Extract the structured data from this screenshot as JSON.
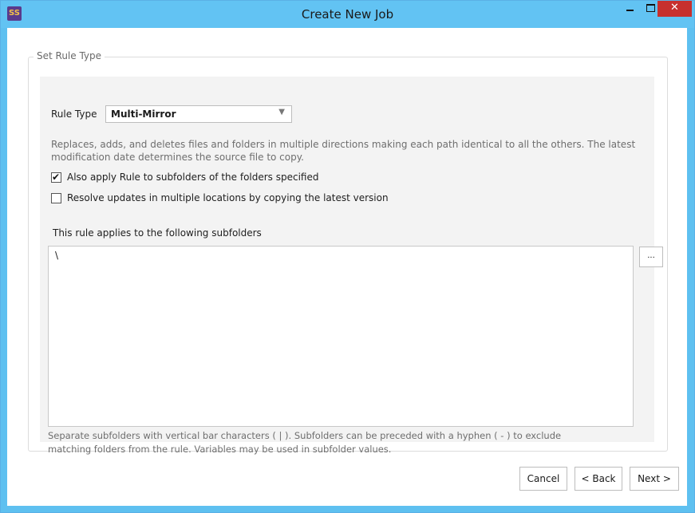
{
  "window": {
    "title": "Create New Job",
    "app_icon_text": "SS"
  },
  "group": {
    "legend": "Set Rule Type"
  },
  "rule_type": {
    "label": "Rule Type",
    "selected": "Multi-Mirror",
    "description_line1": "Replaces, adds, and deletes files and folders in multiple directions making each path identical to all the others. The latest",
    "description_line2": "modification date determines the source file to copy."
  },
  "options": {
    "apply_subfolders": {
      "label": "Also apply Rule to subfolders of the folders specified",
      "checked": true
    },
    "resolve_updates": {
      "label": "Resolve updates in multiple locations by copying the latest version",
      "checked": false
    }
  },
  "subfolders": {
    "heading": "This rule applies to the following subfolders",
    "value": "\\",
    "browse_label": "...",
    "hint_line1": "Separate subfolders with vertical bar characters ( | ). Subfolders can be preceded with a hyphen ( - ) to exclude",
    "hint_line2": "matching folders from the rule. Variables may be used in subfolder values."
  },
  "buttons": {
    "cancel": "Cancel",
    "back": "< Back",
    "next": "Next >"
  }
}
